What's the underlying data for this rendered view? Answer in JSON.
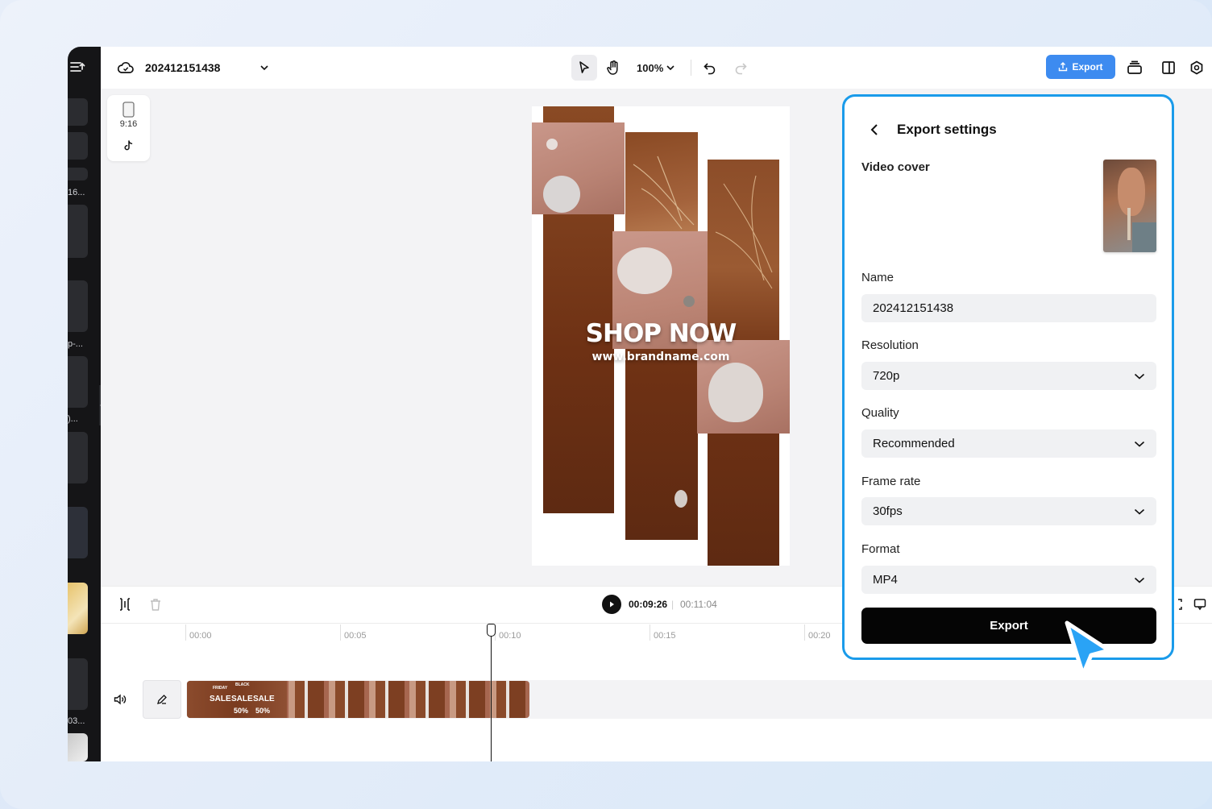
{
  "sidebar": {
    "labels": [
      "16...",
      "p-...",
      ")...",
      "03..."
    ]
  },
  "topbar": {
    "project_name": "202412151438",
    "zoom": "100%",
    "export_label": "Export"
  },
  "canvas": {
    "aspect_ratio": "9:16",
    "preview_headline": "SHOP NOW",
    "preview_url": "www.brandname.com"
  },
  "timeline": {
    "current_time": "00:09:26",
    "separator": "|",
    "total_time": "00:11:04",
    "ticks": [
      "00:00",
      "00:05",
      "00:10",
      "00:15",
      "00:20"
    ],
    "clip_texts": [
      "FRIDAY",
      "BLACK",
      "SALE",
      "SALE",
      "SALE",
      "50%",
      "50%"
    ]
  },
  "export_panel": {
    "title": "Export settings",
    "video_cover_label": "Video cover",
    "name_label": "Name",
    "name_value": "202412151438",
    "resolution_label": "Resolution",
    "resolution_value": "720p",
    "quality_label": "Quality",
    "quality_value": "Recommended",
    "frame_rate_label": "Frame rate",
    "frame_rate_value": "30fps",
    "format_label": "Format",
    "format_value": "MP4",
    "export_button": "Export"
  },
  "colors": {
    "accent_blue": "#3d8bf0",
    "panel_border": "#1a9bea",
    "cursor_blue": "#2aa3f5",
    "brown": "#7a3a18"
  }
}
